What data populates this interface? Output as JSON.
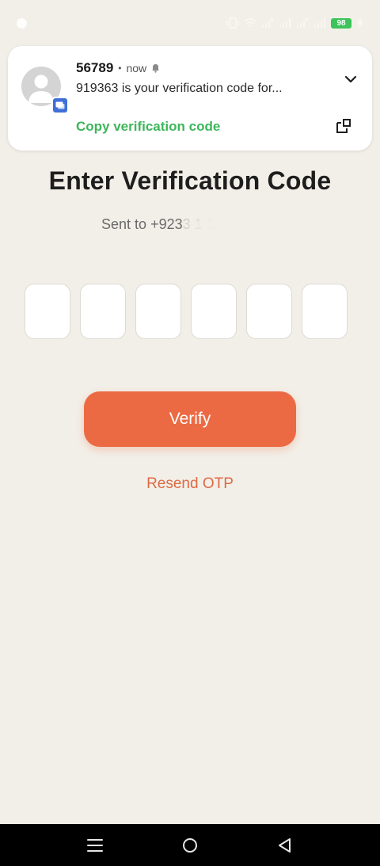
{
  "status_bar": {
    "battery": "98"
  },
  "notification": {
    "sender": "56789",
    "separator": "•",
    "time": "now",
    "message": "919363 is your verification code for...",
    "action_label": "Copy verification code",
    "action_color": "#3db65a",
    "badge_color": "#3f6fd8"
  },
  "main": {
    "title": "Enter Verification Code",
    "sent_to_label": "Sent to",
    "phone_partial": "+9233 1 1",
    "otp_digits": [
      "",
      "",
      "",
      "",
      "",
      ""
    ],
    "verify_label": "Verify",
    "resend_label": "Resend OTP",
    "accent_color": "#ec6a43",
    "background_color": "#f2efe8"
  },
  "icons": {
    "avatar": "person-icon",
    "badge": "messages-icon",
    "bell": "bell-icon",
    "expand": "chevron-down-icon",
    "popout": "popout-icon",
    "nav": [
      "menu-icon",
      "home-icon",
      "back-icon"
    ]
  }
}
